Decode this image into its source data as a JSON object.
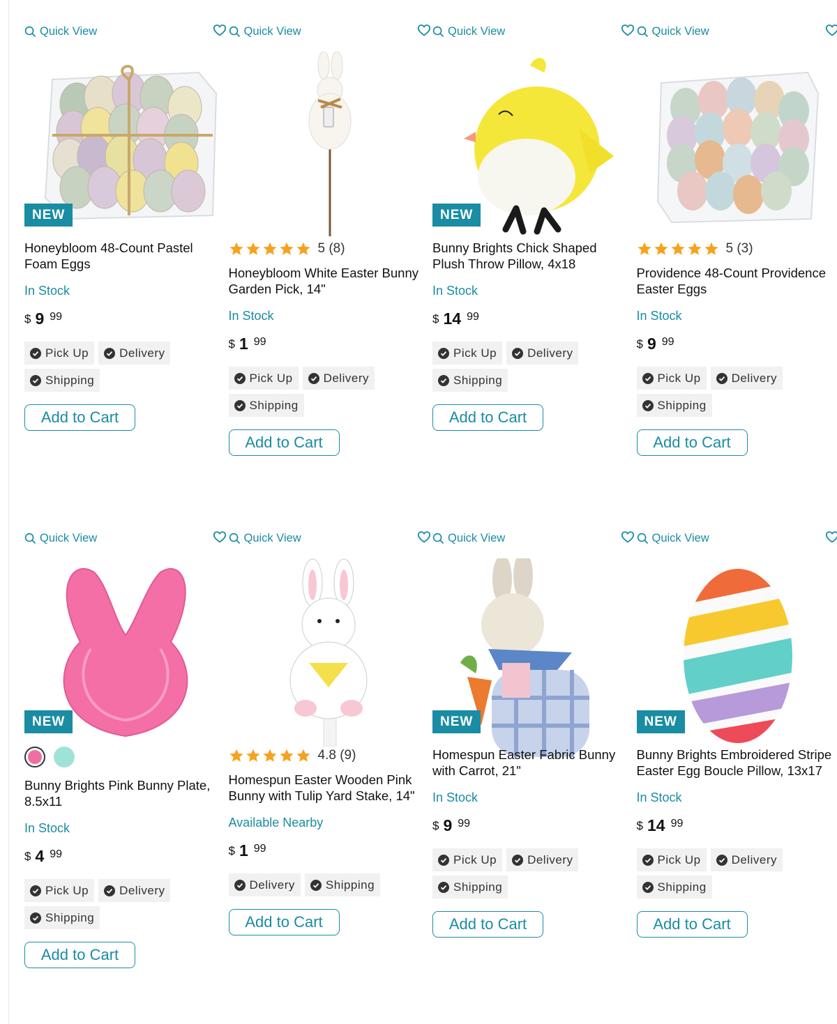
{
  "labels": {
    "quick_view": "Quick View",
    "badge_new": "NEW",
    "in_stock": "In Stock",
    "available_nearby": "Available Nearby",
    "add_to_cart": "Add to Cart",
    "currency": "$"
  },
  "colors": {
    "accent": "#1a8ca3",
    "star": "#f6a21d",
    "chip_bg": "#f1f1f1"
  },
  "products": [
    {
      "title": "Honeybloom 48-Count Pastel Foam Eggs",
      "badge": "NEW",
      "availability": "In Stock",
      "price_dollars": "9",
      "price_cents": "99",
      "fulfillment": [
        "Pick Up",
        "Delivery",
        "Shipping"
      ],
      "image": "pastel-eggs-box"
    },
    {
      "title": "Honeybloom White Easter Bunny Garden Pick, 14\"",
      "rating_value": 5,
      "rating_text": "5 (8)",
      "availability": "In Stock",
      "price_dollars": "1",
      "price_cents": "99",
      "fulfillment": [
        "Pick Up",
        "Delivery",
        "Shipping"
      ],
      "image": "bunny-garden-pick"
    },
    {
      "title": "Bunny Brights Chick Shaped Plush Throw Pillow, 4x18",
      "badge": "NEW",
      "availability": "In Stock",
      "price_dollars": "14",
      "price_cents": "99",
      "fulfillment": [
        "Pick Up",
        "Delivery",
        "Shipping"
      ],
      "image": "chick-pillow"
    },
    {
      "title": "Providence 48-Count Providence Easter Eggs",
      "rating_value": 5,
      "rating_text": "5 (3)",
      "availability": "In Stock",
      "price_dollars": "9",
      "price_cents": "99",
      "fulfillment": [
        "Pick Up",
        "Delivery",
        "Shipping"
      ],
      "image": "easter-eggs-box"
    },
    {
      "title": "Bunny Brights Pink Bunny Plate, 8.5x11",
      "badge": "NEW",
      "swatches": [
        "#f06ea4",
        "#9fe3d8"
      ],
      "availability": "In Stock",
      "price_dollars": "4",
      "price_cents": "99",
      "fulfillment": [
        "Pick Up",
        "Delivery",
        "Shipping"
      ],
      "image": "pink-bunny-plate"
    },
    {
      "title": "Homespun Easter Wooden Pink Bunny with Tulip Yard Stake, 14\"",
      "rating_value": 4.8,
      "rating_text": "4.8 (9)",
      "availability": "Available Nearby",
      "price_dollars": "1",
      "price_cents": "99",
      "fulfillment": [
        "Delivery",
        "Shipping"
      ],
      "image": "bunny-yard-stake"
    },
    {
      "title": "Homespun Easter Fabric Bunny with Carrot, 21\"",
      "badge": "NEW",
      "availability": "In Stock",
      "price_dollars": "9",
      "price_cents": "99",
      "fulfillment": [
        "Pick Up",
        "Delivery",
        "Shipping"
      ],
      "image": "fabric-bunny-carrot"
    },
    {
      "title": "Bunny Brights Embroidered Stripe Easter Egg Boucle Pillow, 13x17",
      "badge": "NEW",
      "availability": "In Stock",
      "price_dollars": "14",
      "price_cents": "99",
      "fulfillment": [
        "Pick Up",
        "Delivery",
        "Shipping"
      ],
      "image": "striped-egg-pillow"
    }
  ]
}
